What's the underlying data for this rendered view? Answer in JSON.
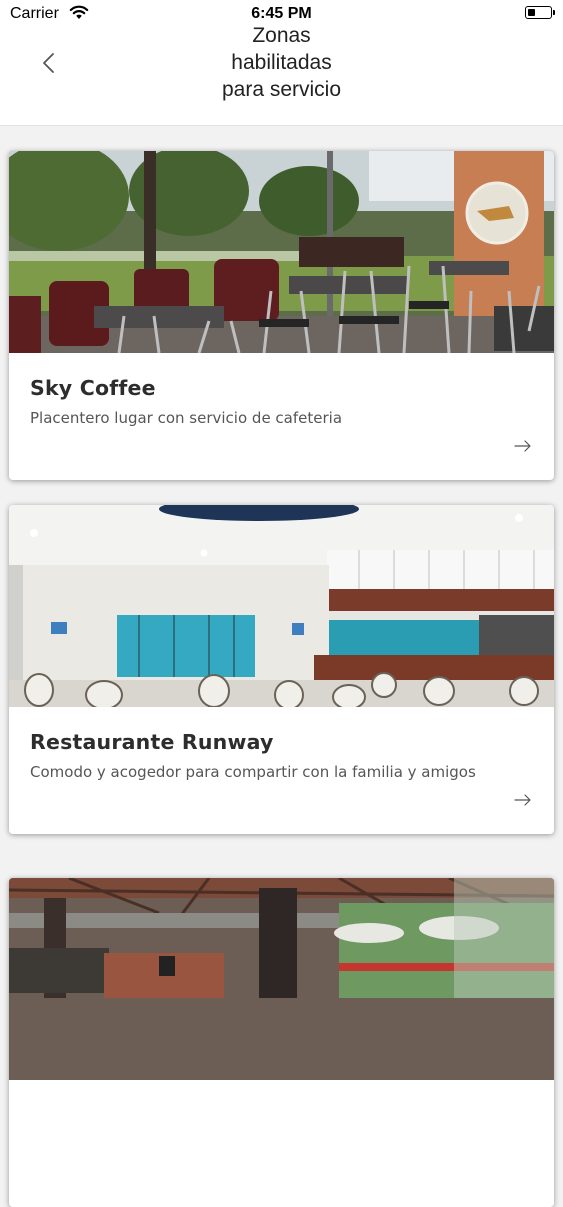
{
  "status_bar": {
    "carrier": "Carrier",
    "time": "6:45 PM",
    "wifi_icon": "wifi-icon",
    "battery_level": 0.35
  },
  "nav": {
    "back_icon": "chevron-left-icon",
    "title_lines": [
      "Zonas",
      "habilitadas",
      "para servicio"
    ]
  },
  "zones": [
    {
      "name": "Sky Coffee",
      "description": "Placentero lugar con servicio de cafeteria",
      "image": "cafe-terrace-photo",
      "arrow_icon": "arrow-right-icon"
    },
    {
      "name": "Restaurante Runway",
      "description": "Comodo y acogedor para compartir con la familia y amigos",
      "image": "restaurant-interior-photo",
      "arrow_icon": "arrow-right-icon"
    },
    {
      "name": "",
      "description": "",
      "image": "covered-patio-photo",
      "arrow_icon": "arrow-right-icon"
    }
  ],
  "colors": {
    "background": "#f2f2f2",
    "card": "#ffffff",
    "title_text": "#2d2d2d",
    "body_text": "#565656"
  }
}
